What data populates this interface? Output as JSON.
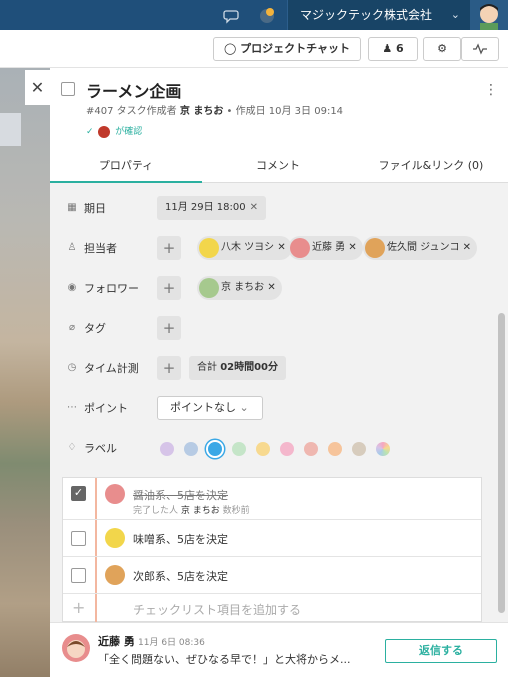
{
  "topbar": {
    "company": "マジックテック株式会社",
    "icons": [
      "chat-bubble-icon",
      "notification-icon",
      "chevron-down-icon",
      "user-avatar"
    ]
  },
  "subbar": {
    "project_chat": "プロジェクトチャット",
    "members_count": "6",
    "icons": [
      "gear-icon",
      "activity-icon"
    ]
  },
  "task": {
    "title": "ラーメン企画",
    "id": "#407",
    "creator_label": "タスク作成者",
    "creator": "京 まちお",
    "created_label": "• 作成日",
    "created_date": "10月 3日 09:14",
    "confirmed": "が確認"
  },
  "tabs": [
    "プロパティ",
    "コメント",
    "ファイル&リンク (0)"
  ],
  "properties": {
    "due_label": "期日",
    "due_value": "11月 29日 18:00",
    "assignee_label": "担当者",
    "assignees": [
      "八木 ツヨシ",
      "近藤 勇",
      "佐久間 ジュンコ"
    ],
    "follower_label": "フォロワー",
    "followers": [
      "京 まちお"
    ],
    "tag_label": "タグ",
    "time_label": "タイム計測",
    "time_total": "合計",
    "time_value": "02時間00分",
    "point_label": "ポイント",
    "point_value": "ポイントなし",
    "label_label": "ラベル",
    "label_colors": [
      "#d6c4e8",
      "#b7cbe4",
      "#3aa8e6",
      "#c5e5c8",
      "#f7d98f",
      "#f4b7cc",
      "#efb7b0",
      "#f6c49b",
      "#d7ccbd",
      "multicolor"
    ],
    "selected_label_index": 2
  },
  "checklist": {
    "items": [
      {
        "text": "醤油系、5店を決定",
        "done": true,
        "sub_label": "完了した人",
        "sub_user": "京 まちお",
        "sub_when": "数秒前"
      },
      {
        "text": "味噌系、5店を決定",
        "done": false
      },
      {
        "text": "次郎系、5店を決定",
        "done": false
      }
    ],
    "add_placeholder": "チェックリスト項目を追加する"
  },
  "comment": {
    "author": "近藤 勇",
    "date": "11月 6日 08:36",
    "text": "「全く問題ない、ぜひなる早で！」と大将からメ...",
    "reply_label": "返信する"
  }
}
